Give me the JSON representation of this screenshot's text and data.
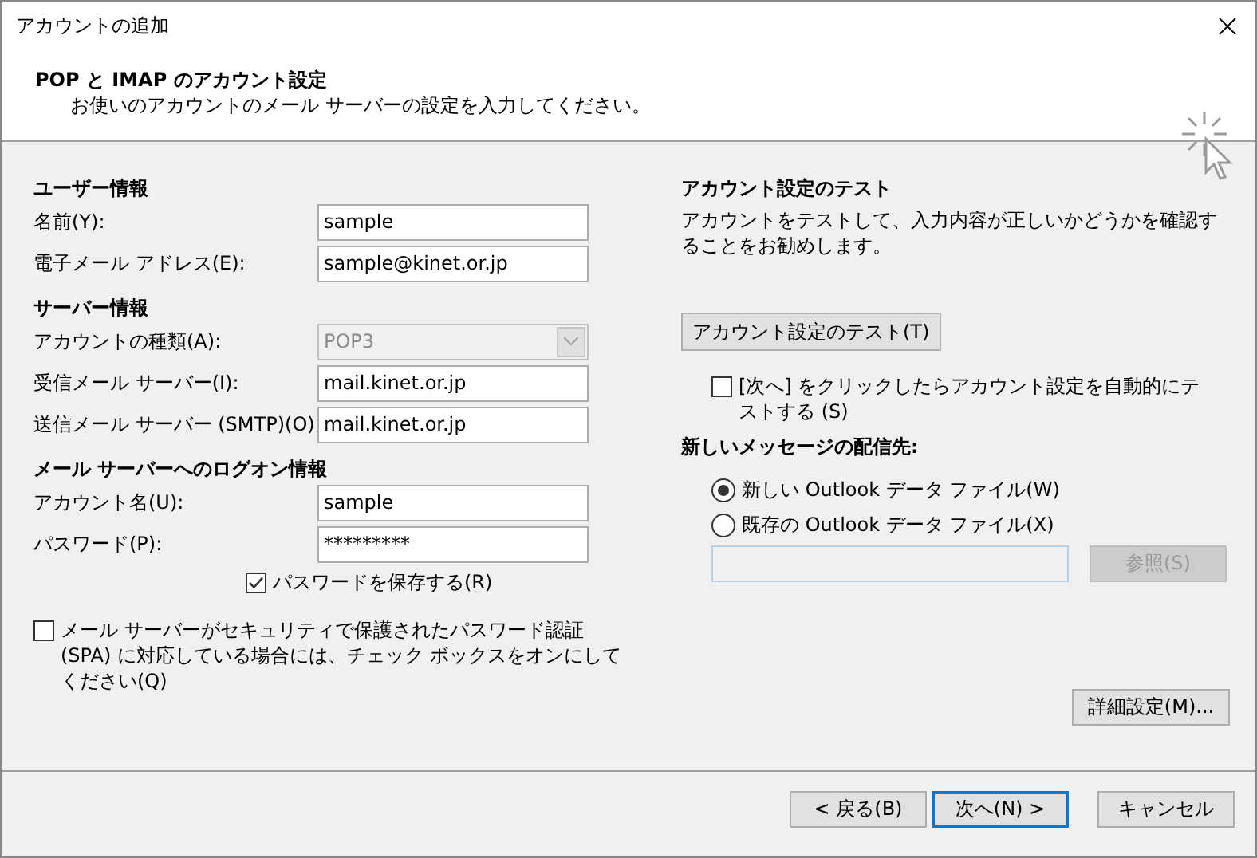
{
  "window": {
    "title": "アカウントの追加"
  },
  "header": {
    "title": "POP と IMAP のアカウント設定",
    "subtitle": "お使いのアカウントのメール サーバーの設定を入力してください。"
  },
  "sections": [
    {
      "heading": "ユーザー情報",
      "rows": [
        {
          "kind": "text",
          "label": "名前(Y):",
          "value": "sample",
          "disabled": false
        },
        {
          "kind": "text",
          "label": "電子メール アドレス(E):",
          "value": "sample@kinet.or.jp",
          "disabled": false
        }
      ]
    },
    {
      "heading": "サーバー情報",
      "rows": [
        {
          "kind": "select",
          "label": "アカウントの種類(A):",
          "value": "POP3",
          "disabled": true
        },
        {
          "kind": "text",
          "label": "受信メール サーバー(I):",
          "value": "mail.kinet.or.jp",
          "disabled": false
        },
        {
          "kind": "text",
          "label": "送信メール サーバー (SMTP)(O):",
          "value": "mail.kinet.or.jp",
          "disabled": false
        }
      ]
    },
    {
      "heading": "メール サーバーへのログオン情報",
      "rows": [
        {
          "kind": "text",
          "label": "アカウント名(U):",
          "value": "sample",
          "disabled": false
        },
        {
          "kind": "text",
          "label": "パスワード(P):",
          "value": "*********",
          "disabled": false
        }
      ]
    }
  ],
  "remember_password": {
    "label": "パスワードを保存する(R)",
    "checked": true
  },
  "spa": {
    "label": "メール サーバーがセキュリティで保護されたパスワード認証 (SPA) に対応している場合には、チェック ボックスをオンにしてください(Q)",
    "checked": false
  },
  "test": {
    "heading": "アカウント設定のテスト",
    "description": "アカウントをテストして、入力内容が正しいかどうかを確認することをお勧めします。",
    "button": "アカウント設定のテスト(T)",
    "auto_test": {
      "label": "[次へ] をクリックしたらアカウント設定を自動的にテストする (S)",
      "checked": false
    }
  },
  "delivery": {
    "heading": "新しいメッセージの配信先:",
    "options": [
      {
        "label": "新しい Outlook データ ファイル(W)",
        "selected": true
      },
      {
        "label": "既存の Outlook データ ファイル(X)",
        "selected": false
      }
    ],
    "browse_button": {
      "label": "参照(S)",
      "disabled": true
    }
  },
  "advanced_button": "詳細設定(M)...",
  "footer_buttons": [
    {
      "label": "< 戻る(B)",
      "kind": "normal"
    },
    {
      "label": "次へ(N) >",
      "kind": "default"
    },
    {
      "label": "キャンセル",
      "kind": "normal"
    }
  ]
}
